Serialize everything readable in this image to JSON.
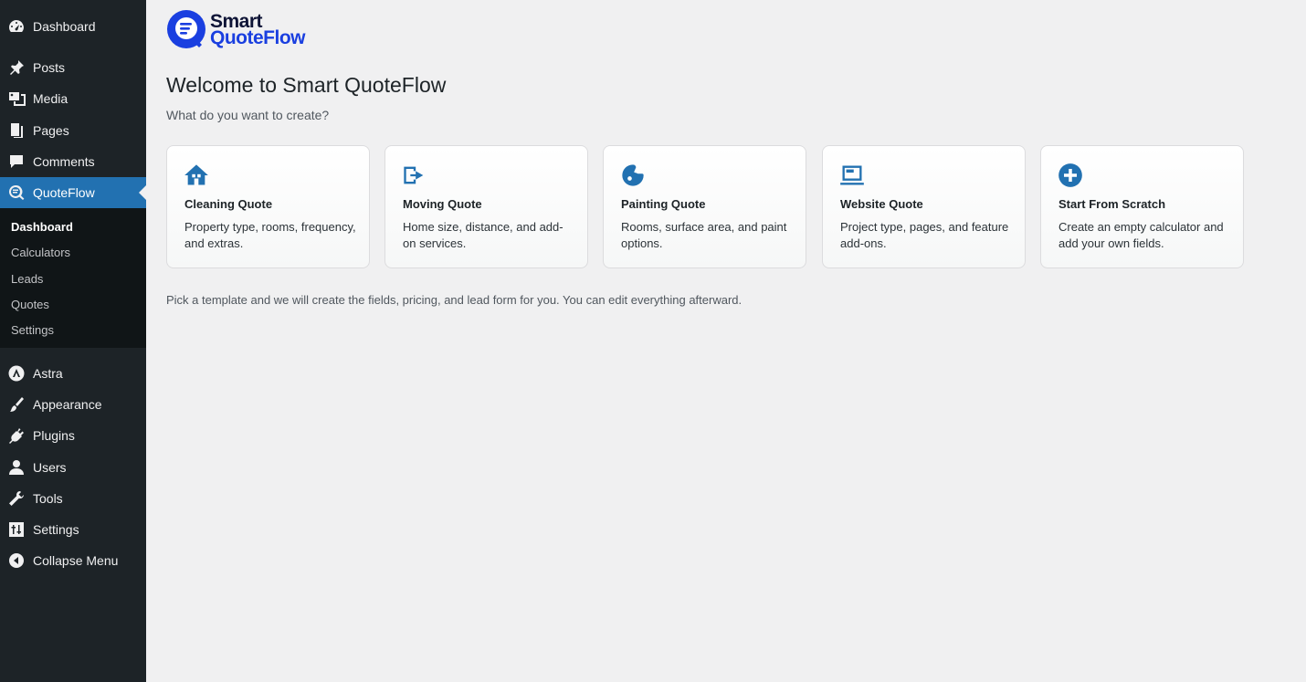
{
  "sidebar": {
    "items": [
      {
        "label": "Dashboard",
        "icon": "dashboard-icon"
      },
      {
        "label": "Posts",
        "icon": "pin-icon"
      },
      {
        "label": "Media",
        "icon": "media-icon"
      },
      {
        "label": "Pages",
        "icon": "pages-icon"
      },
      {
        "label": "Comments",
        "icon": "comment-icon"
      },
      {
        "label": "QuoteFlow",
        "icon": "quoteflow-icon",
        "current": true
      },
      {
        "label": "Astra",
        "icon": "astra-icon"
      },
      {
        "label": "Appearance",
        "icon": "brush-icon"
      },
      {
        "label": "Plugins",
        "icon": "plug-icon"
      },
      {
        "label": "Users",
        "icon": "user-icon"
      },
      {
        "label": "Tools",
        "icon": "wrench-icon"
      },
      {
        "label": "Settings",
        "icon": "sliders-icon"
      },
      {
        "label": "Collapse Menu",
        "icon": "collapse-icon"
      }
    ],
    "submenu": [
      {
        "label": "Dashboard",
        "current": true
      },
      {
        "label": "Calculators"
      },
      {
        "label": "Leads"
      },
      {
        "label": "Quotes"
      },
      {
        "label": "Settings"
      }
    ]
  },
  "logo": {
    "line1": "Smart",
    "line2": "QuoteFlow"
  },
  "page": {
    "title": "Welcome to Smart QuoteFlow",
    "subtitle": "What do you want to create?",
    "hint": "Pick a template and we will create the fields, pricing, and lead form for you. You can edit everything afterward."
  },
  "cards": [
    {
      "title": "Cleaning Quote",
      "desc": "Property type, rooms, frequency, and extras.",
      "icon": "home-icon"
    },
    {
      "title": "Moving Quote",
      "desc": "Home size, distance, and add-on services.",
      "icon": "moving-arrow-icon"
    },
    {
      "title": "Painting Quote",
      "desc": "Rooms, surface area, and paint options.",
      "icon": "paint-icon"
    },
    {
      "title": "Website Quote",
      "desc": "Project type, pages, and feature add-ons.",
      "icon": "laptop-icon"
    },
    {
      "title": "Start From Scratch",
      "desc": "Create an empty calculator and add your own fields.",
      "icon": "plus-circle-icon"
    }
  ],
  "colors": {
    "accent": "#2271b1",
    "sidebar": "#1d2327",
    "submenu": "#101517",
    "brand_blue": "#1a3fe0"
  }
}
